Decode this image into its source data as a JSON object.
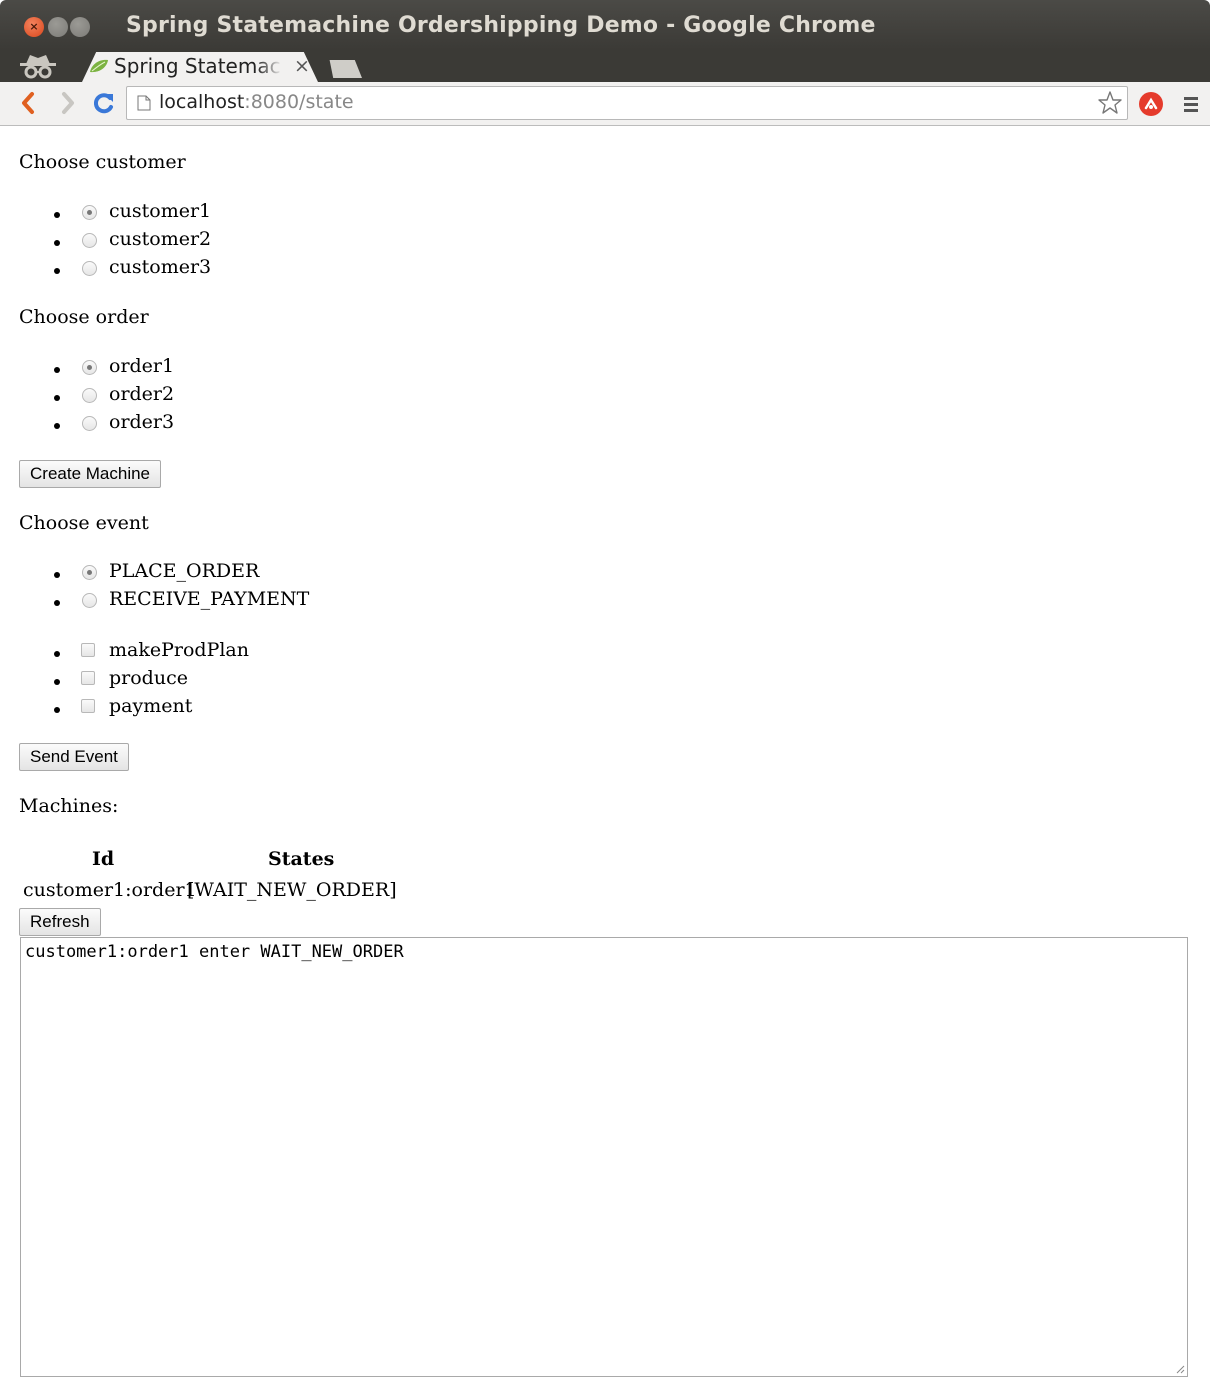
{
  "window": {
    "title": "Spring Statemachine Ordershipping Demo - Google Chrome",
    "close_glyph": "×"
  },
  "tab": {
    "label": "Spring Statemachine Ordershipping Demo",
    "close_glyph": "×",
    "favicon": "spring-leaf-icon"
  },
  "address_bar": {
    "host": "localhost",
    "rest": ":8080/state"
  },
  "page": {
    "customer_label": "Choose customer",
    "customers": [
      {
        "label": "customer1",
        "checked": true
      },
      {
        "label": "customer2",
        "checked": false
      },
      {
        "label": "customer3",
        "checked": false
      }
    ],
    "order_label": "Choose order",
    "orders": [
      {
        "label": "order1",
        "checked": true
      },
      {
        "label": "order2",
        "checked": false
      },
      {
        "label": "order3",
        "checked": false
      }
    ],
    "create_button": "Create Machine",
    "event_label": "Choose event",
    "events": [
      {
        "label": "PLACE_ORDER",
        "checked": true
      },
      {
        "label": "RECEIVE_PAYMENT",
        "checked": false
      }
    ],
    "options": [
      {
        "label": "makeProdPlan",
        "checked": false
      },
      {
        "label": "produce",
        "checked": false
      },
      {
        "label": "payment",
        "checked": false
      }
    ],
    "send_button": "Send Event",
    "machines_label": "Machines:",
    "table": {
      "headers": [
        "Id",
        "States"
      ],
      "rows": [
        {
          "id": "customer1:order1",
          "states": "[WAIT_NEW_ORDER]"
        }
      ]
    },
    "refresh_button": "Refresh",
    "log_text": "customer1:order1 enter WAIT_NEW_ORDER"
  },
  "colors": {
    "titlebar": "#3b3a36",
    "close_button": "#e95420",
    "reload_icon": "#3a78d8",
    "back_icon": "#e06020"
  }
}
